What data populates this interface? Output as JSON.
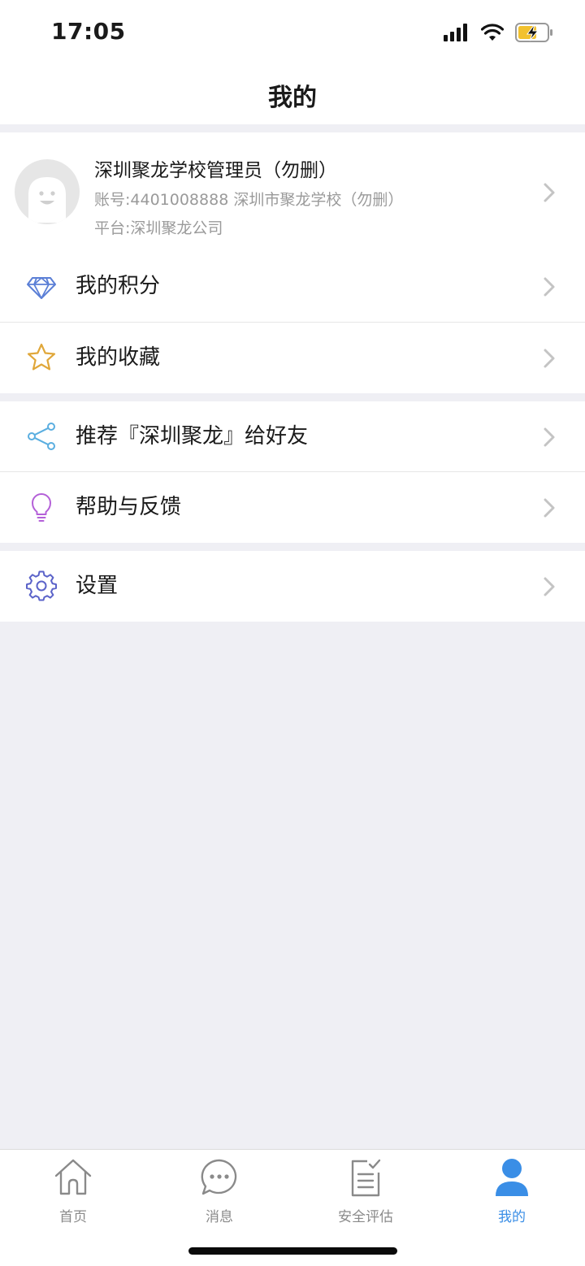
{
  "status_bar": {
    "time": "17:05"
  },
  "nav": {
    "title": "我的"
  },
  "profile": {
    "name": "深圳聚龙学校管理员（勿删）",
    "account": "账号:4401008888 深圳市聚龙学校（勿删）",
    "platform": "平台:深圳聚龙公司"
  },
  "menu": {
    "points": "我的积分",
    "favorites": "我的收藏",
    "recommend": "推荐『深圳聚龙』给好友",
    "help": "帮助与反馈",
    "settings": "设置"
  },
  "tabs": {
    "home": "首页",
    "messages": "消息",
    "safety": "安全评估",
    "mine": "我的",
    "active": "mine"
  },
  "colors": {
    "accent": "#3a8ee6",
    "diamond": "#5b7fd6",
    "star": "#e0a73a",
    "share": "#5aaee0",
    "bulb": "#b460d8",
    "gear": "#5b63c9"
  }
}
